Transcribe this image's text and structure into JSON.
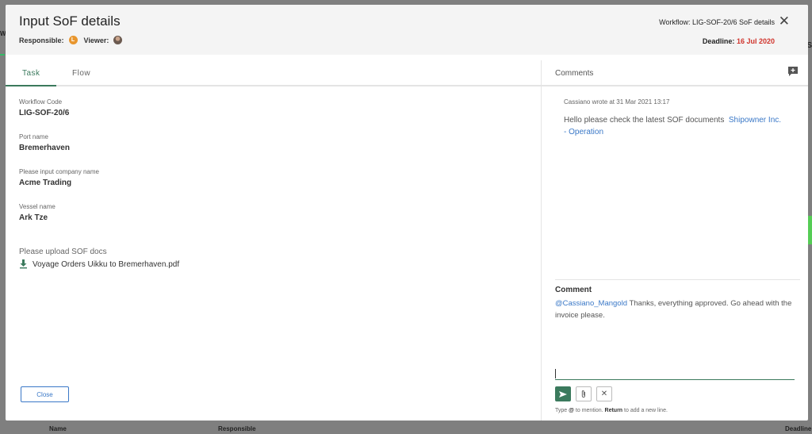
{
  "background": {
    "left_label": "W",
    "right_label": "S",
    "bottom_columns": [
      "Name",
      "Responsible",
      "Deadline"
    ]
  },
  "header": {
    "title": "Input SoF details",
    "responsible_label": "Responsible:",
    "responsible_initial": "L",
    "viewer_label": "Viewer:",
    "workflow": "Workflow: LIG-SOF-20/6 SoF details",
    "deadline_label": "Deadline:",
    "deadline_date": "16 Jul 2020",
    "deadline_color": "#d0342c"
  },
  "tabs": [
    {
      "label": "Task",
      "active": true
    },
    {
      "label": "Flow",
      "active": false
    }
  ],
  "fields": [
    {
      "label": "Workflow Code",
      "value": "LIG-SOF-20/6"
    },
    {
      "label": "Port name",
      "value": "Bremerhaven"
    },
    {
      "label": "Please input company name",
      "value": "Acme Trading"
    },
    {
      "label": "Vessel name",
      "value": "Ark Tze"
    }
  ],
  "upload": {
    "label": "Please upload SOF docs",
    "file_name": "Voyage Orders Uikku to Bremerhaven.pdf",
    "file_icon": "download-icon"
  },
  "close_button": "Close",
  "comments": {
    "title": "Comments",
    "add_icon": "add-comment-icon",
    "items": [
      {
        "author_line": "Cassiano wrote at 31 Mar 2021 13:17",
        "text": "Hello please check the latest SOF documents",
        "mention": "Shipowner Inc. - Operation"
      }
    ],
    "compose_label": "Comment",
    "draft_mention": "@Cassiano_Mangold",
    "draft_text": "Thanks, everything approved. Go ahead with the invoice please.",
    "input_value": "",
    "hint_prefix": "Type",
    "hint_at": "@",
    "hint_mid": "to mention.",
    "hint_return": "Return",
    "hint_suffix": "to add a new line.",
    "accent_color": "#3b7a5d",
    "mention_color": "#3a78c7"
  }
}
